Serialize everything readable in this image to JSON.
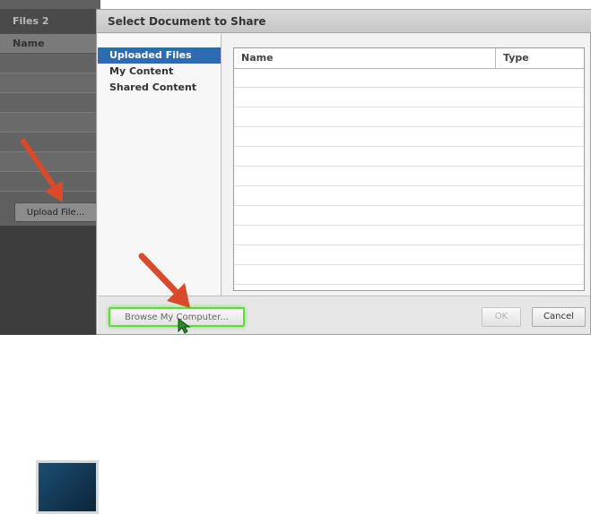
{
  "background_app": {
    "panel_title": "Files 2",
    "column_header": "Name",
    "upload_button": "Upload File..."
  },
  "dialog": {
    "title": "Select Document to Share",
    "sidebar": [
      {
        "label": "Uploaded Files",
        "selected": true
      },
      {
        "label": "My Content",
        "selected": false
      },
      {
        "label": "Shared Content",
        "selected": false
      }
    ],
    "table": {
      "columns": [
        "Name",
        "Type"
      ],
      "rows": []
    },
    "buttons": {
      "browse": "Browse My Computer...",
      "ok": "OK",
      "cancel": "Cancel"
    }
  },
  "colors": {
    "selection": "#2d6bb5",
    "annotation_arrow": "#d94a2b",
    "highlight": "#5fdc3c"
  },
  "icons": [
    "arrow-annotation",
    "mouse-cursor-icon"
  ]
}
